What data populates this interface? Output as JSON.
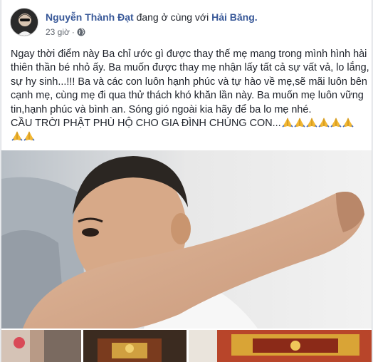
{
  "post": {
    "author": "Nguyễn Thành Đạt",
    "with_text": "đang ở cùng với",
    "tagged": "Hải Băng.",
    "time": "23 giờ",
    "audience_icon": "globe-icon",
    "lines": [
      "Ngay thời điểm này Ba chỉ ước gì được thay thế mẹ mang trong mình hình hài",
      "thiên thần bé nhỏ ấy. Ba muốn được thay mẹ nhận lấy tất cả sự vất vả, lo lắng,",
      "sự hy sinh...!!! Ba và các con luôn hạnh phúc và tự hào về mẹ,sẽ mãi luôn bên",
      "cạnh mẹ, cùng mẹ đi qua thử thách khó khăn lần này. Ba muốn mẹ luôn vững",
      "tin,hạnh phúc và bình an. Sóng gió ngoài kia hãy để ba lo mẹ nhé.",
      "CẦU TRỜI PHẬT PHÙ HỘ CHO GIA ĐÌNH CHÚNG CON..."
    ],
    "emoji_icon": "folded-hands-icon",
    "emoji_count_line6": 6,
    "emoji_count_line7": 2
  },
  "colors": {
    "link": "#385898",
    "text": "#1d2129",
    "meta": "#616770",
    "emoji": "#f2b733"
  }
}
